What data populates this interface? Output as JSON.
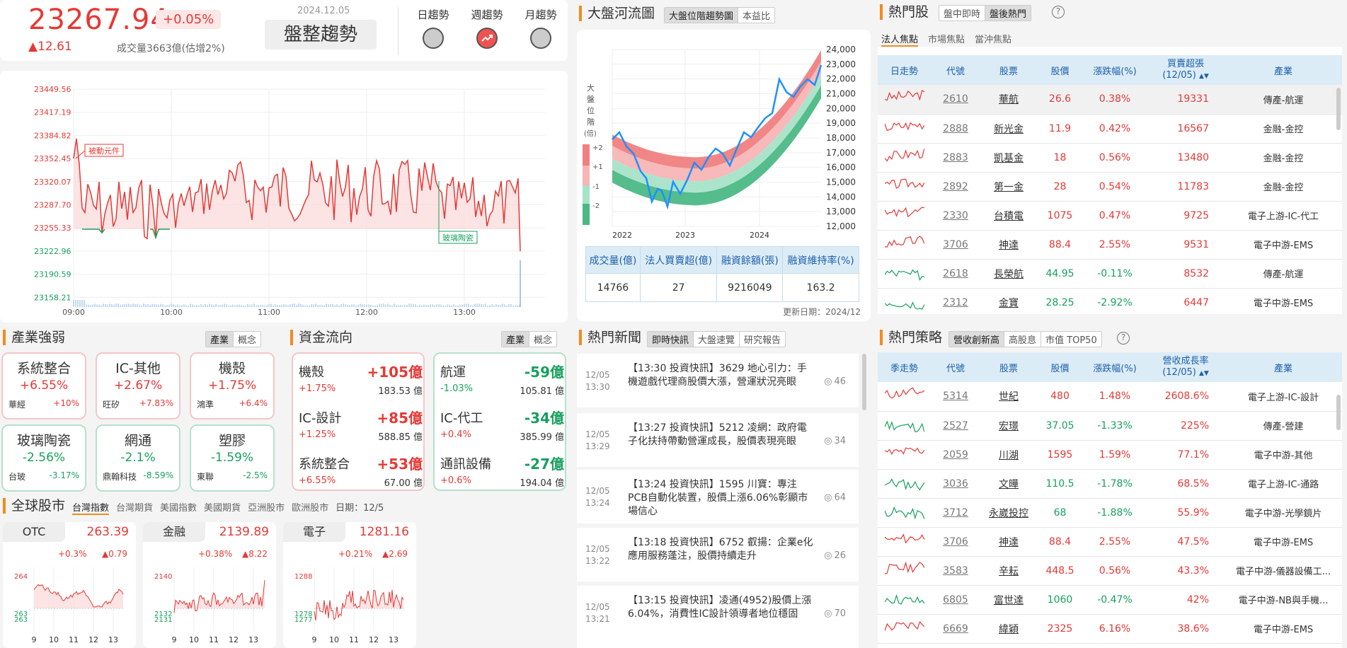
{
  "index": {
    "value": "23267.94",
    "pct": "+0.05%",
    "change": "▲12.61",
    "volume": "成交量3663億(估增2%)",
    "date": "2024.12.05",
    "trend_label": "盤整趨勢",
    "trend_tabs": [
      "日趨勢",
      "週趨勢",
      "月趨勢"
    ]
  },
  "intraday": {
    "y_ticks": [
      "23449.56",
      "23417.19",
      "23384.82",
      "23352.45",
      "23320.07",
      "23287.70",
      "23255.33",
      "23222.96",
      "23190.59",
      "23158.21"
    ],
    "x_ticks": [
      "09:00",
      "10:00",
      "11:00",
      "12:00",
      "13:00"
    ],
    "annotations": [
      "被動元件",
      "玻璃陶瓷"
    ]
  },
  "river": {
    "title": "大盤河流圖",
    "tabs": [
      "大盤位階趨勢圖",
      "本益比"
    ],
    "y_ticks": [
      "24,000",
      "23,000",
      "22,000",
      "21,000",
      "20,000",
      "19,000",
      "18,000",
      "17,000",
      "16,000",
      "15,000",
      "14,000",
      "13,000",
      "12,000"
    ],
    "x_ticks": [
      "2022",
      "2023",
      "2024"
    ],
    "side_label": [
      "大",
      "盤",
      "位",
      "階",
      "(倍)"
    ],
    "legend": [
      "+2",
      "+1",
      "-1",
      "-2"
    ],
    "table_headers": [
      "成交量(億)",
      "法人買賣超(億)",
      "融資餘額(張)",
      "融資維持率(%)"
    ],
    "table_values": [
      "14766",
      "27",
      "9216049",
      "163.2"
    ],
    "updated": "更新日期：2024/12"
  },
  "hot_stocks": {
    "title": "熱門股",
    "tabs": [
      "盤中即時",
      "盤後熱門"
    ],
    "subtabs": [
      "法人焦點",
      "市場焦點",
      "當沖焦點"
    ],
    "headers": [
      "日走勢",
      "代號",
      "股票",
      "股價",
      "漲跌幅(%)",
      "買賣超張\n(12/05)",
      "產業"
    ],
    "rows": [
      {
        "code": "2610",
        "name": "華航",
        "price": "26.6",
        "pct": "0.38%",
        "vol": "19331",
        "ind": "傳產-航運",
        "up": true
      },
      {
        "code": "2888",
        "name": "新光金",
        "price": "11.9",
        "pct": "0.42%",
        "vol": "16567",
        "ind": "金融-金控",
        "up": true
      },
      {
        "code": "2883",
        "name": "凱基金",
        "price": "18",
        "pct": "0.56%",
        "vol": "13480",
        "ind": "金融-金控",
        "up": true
      },
      {
        "code": "2892",
        "name": "第一金",
        "price": "28",
        "pct": "0.54%",
        "vol": "11783",
        "ind": "金融-金控",
        "up": true
      },
      {
        "code": "2330",
        "name": "台積電",
        "price": "1075",
        "pct": "0.47%",
        "vol": "9725",
        "ind": "電子上游-IC-代工",
        "up": true
      },
      {
        "code": "3706",
        "name": "神達",
        "price": "88.4",
        "pct": "2.55%",
        "vol": "9531",
        "ind": "電子中游-EMS",
        "up": true
      },
      {
        "code": "2618",
        "name": "長榮航",
        "price": "44.95",
        "pct": "-0.11%",
        "vol": "8532",
        "ind": "傳產-航運",
        "up": false
      },
      {
        "code": "2312",
        "name": "金寶",
        "price": "28.25",
        "pct": "-2.92%",
        "vol": "6447",
        "ind": "電子中游-EMS",
        "up": false
      }
    ]
  },
  "industry": {
    "title": "產業強弱",
    "tabs": [
      "產業",
      "概念"
    ],
    "cards": [
      {
        "name": "系統整合",
        "pct": "+6.55%",
        "stock": "華經",
        "spct": "+10%",
        "up": true
      },
      {
        "name": "IC-其他",
        "pct": "+2.67%",
        "stock": "旺矽",
        "spct": "+7.83%",
        "up": true
      },
      {
        "name": "機殼",
        "pct": "+1.75%",
        "stock": "鴻準",
        "spct": "+6.4%",
        "up": true
      },
      {
        "name": "玻璃陶瓷",
        "pct": "-2.56%",
        "stock": "台玻",
        "spct": "-3.17%",
        "up": false
      },
      {
        "name": "網通",
        "pct": "-2.1%",
        "stock": "鼎翰科技",
        "spct": "-8.59%",
        "up": false
      },
      {
        "name": "塑膠",
        "pct": "-1.59%",
        "stock": "東聯",
        "spct": "-2.5%",
        "up": false
      }
    ]
  },
  "flow": {
    "title": "資金流向",
    "tabs": [
      "產業",
      "概念"
    ],
    "inflow": [
      {
        "name": "機殼",
        "amt": "+105億",
        "pct": "+1.75%",
        "total": "183.53 億"
      },
      {
        "name": "IC-設計",
        "amt": "+85億",
        "pct": "+1.25%",
        "total": "588.85 億"
      },
      {
        "name": "系統整合",
        "amt": "+53億",
        "pct": "+6.55%",
        "total": "67.00 億"
      }
    ],
    "outflow": [
      {
        "name": "航運",
        "amt": "-59億",
        "pct": "-1.03%",
        "total": "105.81 億"
      },
      {
        "name": "IC-代工",
        "amt": "-34億",
        "pct": "+0.4%",
        "total": "385.99 億"
      },
      {
        "name": "通訊設備",
        "amt": "-27億",
        "pct": "+0.6%",
        "total": "194.04 億"
      }
    ]
  },
  "global": {
    "title": "全球股市",
    "tabs": [
      "台灣指數",
      "台灣期貨",
      "美國指數",
      "美國期貨",
      "亞洲股市",
      "歐洲股市"
    ],
    "date": "日期：12/5",
    "cards": [
      {
        "name": "OTC",
        "value": "263.39",
        "pct": "+0.3%",
        "chg": "▲0.79",
        "ytop": "264",
        "ybot1": "263",
        "ybot2": "263"
      },
      {
        "name": "金融",
        "value": "2139.89",
        "pct": "+0.38%",
        "chg": "▲8.22",
        "ytop": "2140",
        "ybot1": "2132",
        "ybot2": "2131"
      },
      {
        "name": "電子",
        "value": "1281.16",
        "pct": "+0.21%",
        "chg": "▲2.69",
        "ytop": "1288",
        "ybot1": "1278",
        "ybot2": "1277"
      }
    ],
    "x_ticks": [
      "9",
      "10",
      "11",
      "12",
      "13"
    ]
  },
  "news": {
    "title": "熱門新聞",
    "tabs": [
      "即時快訊",
      "大盤速覽",
      "研究報告"
    ],
    "items": [
      {
        "date": "12/05",
        "time": "13:30",
        "text": "【13:30 投資快訊】3629 地心引力：手機遊戲代理商股價大漲，營運狀況亮眼",
        "views": "46"
      },
      {
        "date": "12/05",
        "time": "13:29",
        "text": "【13:27 投資快訊】5212 凌網：政府電子化扶持帶動營運成長，股價表現亮眼",
        "views": "34"
      },
      {
        "date": "12/05",
        "time": "13:24",
        "text": "【13:24 投資快訊】1595 川寶：專注PCB自動化裝置，股價上漲6.06%彰顯市場信心",
        "views": "64"
      },
      {
        "date": "12/05",
        "time": "13:22",
        "text": "【13:18 投資快訊】6752 叡揚：企業e化應用服務蓬注，股價持續走升",
        "views": "26"
      },
      {
        "date": "12/05",
        "time": "13:21",
        "text": "【13:15 投資快訊】凌通(4952)股價上漲6.04%，消費性IC設計領導者地位穩固",
        "views": "70"
      }
    ]
  },
  "strategy": {
    "title": "熱門策略",
    "tabs": [
      "營收創新高",
      "高股息",
      "市值 TOP50"
    ],
    "headers": [
      "季走勢",
      "代號",
      "股票",
      "股價",
      "漲跌幅(%)",
      "營收成長率\n(12/05)",
      "產業"
    ],
    "rows": [
      {
        "code": "5314",
        "name": "世紀",
        "price": "480",
        "pct": "1.48%",
        "rate": "2608.6%",
        "ind": "電子上游-IC-設計",
        "up": true
      },
      {
        "code": "2527",
        "name": "宏璟",
        "price": "37.05",
        "pct": "-1.33%",
        "rate": "225%",
        "ind": "傳產-營建",
        "up": false
      },
      {
        "code": "2059",
        "name": "川湖",
        "price": "1595",
        "pct": "1.59%",
        "rate": "77.1%",
        "ind": "電子中游-其他",
        "up": true
      },
      {
        "code": "3036",
        "name": "文曄",
        "price": "110.5",
        "pct": "-1.78%",
        "rate": "68.5%",
        "ind": "電子上游-IC-通路",
        "up": false
      },
      {
        "code": "3712",
        "name": "永崴投控",
        "price": "68",
        "pct": "-1.88%",
        "rate": "55.9%",
        "ind": "電子中游-光學鏡片",
        "up": false
      },
      {
        "code": "3706",
        "name": "神達",
        "price": "88.4",
        "pct": "2.55%",
        "rate": "47.5%",
        "ind": "電子中游-EMS",
        "up": true
      },
      {
        "code": "3583",
        "name": "辛耘",
        "price": "448.5",
        "pct": "0.56%",
        "rate": "43.3%",
        "ind": "電子中游-儀器設備工...",
        "up": true
      },
      {
        "code": "6805",
        "name": "富世達",
        "price": "1060",
        "pct": "-0.47%",
        "rate": "42%",
        "ind": "電子中游-NB與手機...",
        "up": false
      },
      {
        "code": "6669",
        "name": "緯穎",
        "price": "2325",
        "pct": "6.16%",
        "rate": "38.6%",
        "ind": "電子中游-EMS",
        "up": true
      }
    ]
  }
}
